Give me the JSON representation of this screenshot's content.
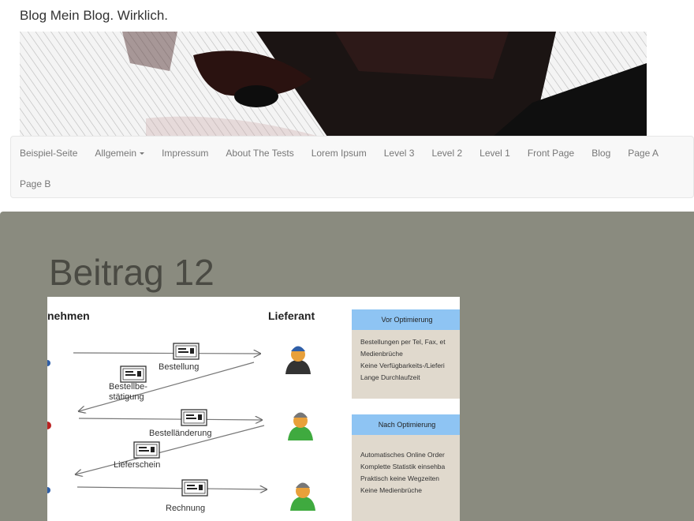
{
  "site": {
    "title": "Blog Mein Blog. Wirklich."
  },
  "nav": {
    "row1": [
      "Beispiel-Seite",
      "Allgemein",
      "Impressum",
      "About The Tests",
      "Lorem Ipsum",
      "Level 3",
      "Level 2",
      "Level 1",
      "Front Page",
      "Blog",
      "Page A"
    ],
    "row2": [
      "Page B"
    ]
  },
  "post": {
    "title": "Beitrag 12"
  },
  "figure": {
    "left_heading": "nehmen",
    "right_heading": "Lieferant",
    "labels": {
      "bestellung": "Bestellung",
      "bestaetigung_1": "Bestellbe-",
      "bestaetigung_2": "stätigung",
      "aenderung": "Bestelländerung",
      "lieferschein": "Lieferschein",
      "rechnung": "Rechnung"
    },
    "box_before": {
      "heading": "Vor Optimierung",
      "lines": [
        "Bestellungen per Tel, Fax, et",
        "Medienbrüche",
        "Keine Verfügbarkeits-/Lieferi",
        "Lange Durchlaufzeit"
      ]
    },
    "box_after": {
      "heading": "Nach Optimierung",
      "lines": [
        "Automatisches Online Order",
        "Komplette Statistik einsehba",
        "Praktisch keine Wegzeiten",
        "Keine Medienbrüche"
      ]
    }
  },
  "colors": {
    "main_bg": "#8a8b7f",
    "box_header": "#8ec4f3",
    "box_body": "#e0d9cd",
    "avatar_top_1": "#2f5fa8",
    "avatar_top_2": "#777777",
    "avatar_body_1": "#333333",
    "avatar_body_2": "#3faa3f"
  }
}
